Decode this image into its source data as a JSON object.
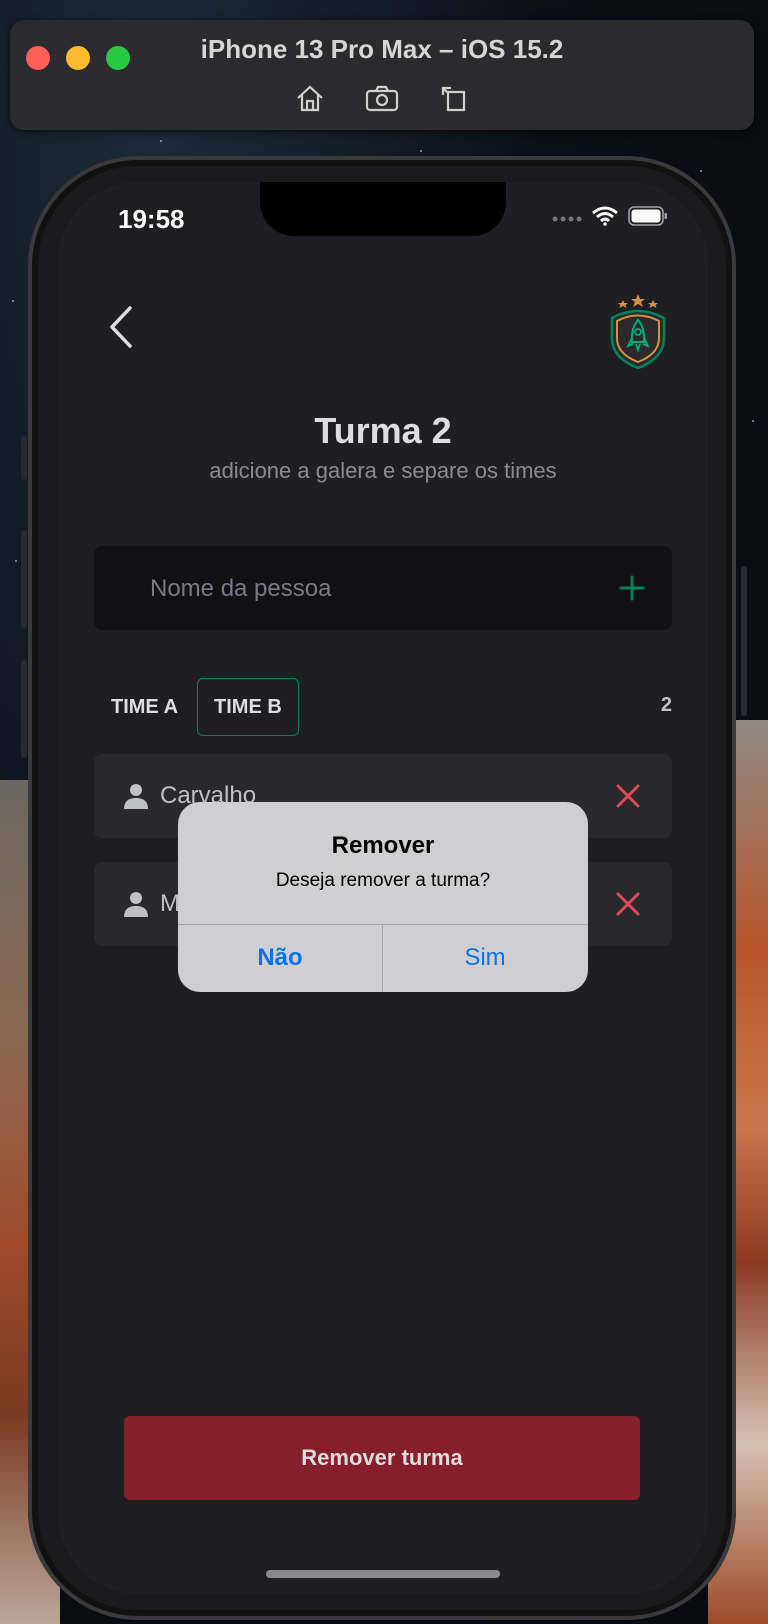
{
  "simulator": {
    "title": "iPhone 13 Pro Max – iOS 15.2",
    "tools": [
      "home-icon",
      "screenshot-icon",
      "rotate-icon"
    ]
  },
  "status_bar": {
    "time": "19:58"
  },
  "header": {
    "logo": "rocket-shield-logo"
  },
  "page": {
    "title": "Turma 2",
    "subtitle": "adicione a galera e separe os times"
  },
  "input": {
    "placeholder": "Nome da pessoa",
    "value": ""
  },
  "tabs": [
    {
      "label": "TIME A",
      "active": false
    },
    {
      "label": "TIME B",
      "active": true
    }
  ],
  "player_count": "2",
  "players": [
    {
      "name": "Carvalho"
    },
    {
      "name": "M"
    }
  ],
  "footer": {
    "remove_button": "Remover turma"
  },
  "alert": {
    "title": "Remover",
    "message": "Deseja remover a turma?",
    "cancel": "Não",
    "confirm": "Sim"
  },
  "colors": {
    "accent": "#00875f",
    "danger": "#8a1f2c",
    "remove_icon": "#e14b5a",
    "alert_button": "#0a73e8"
  }
}
